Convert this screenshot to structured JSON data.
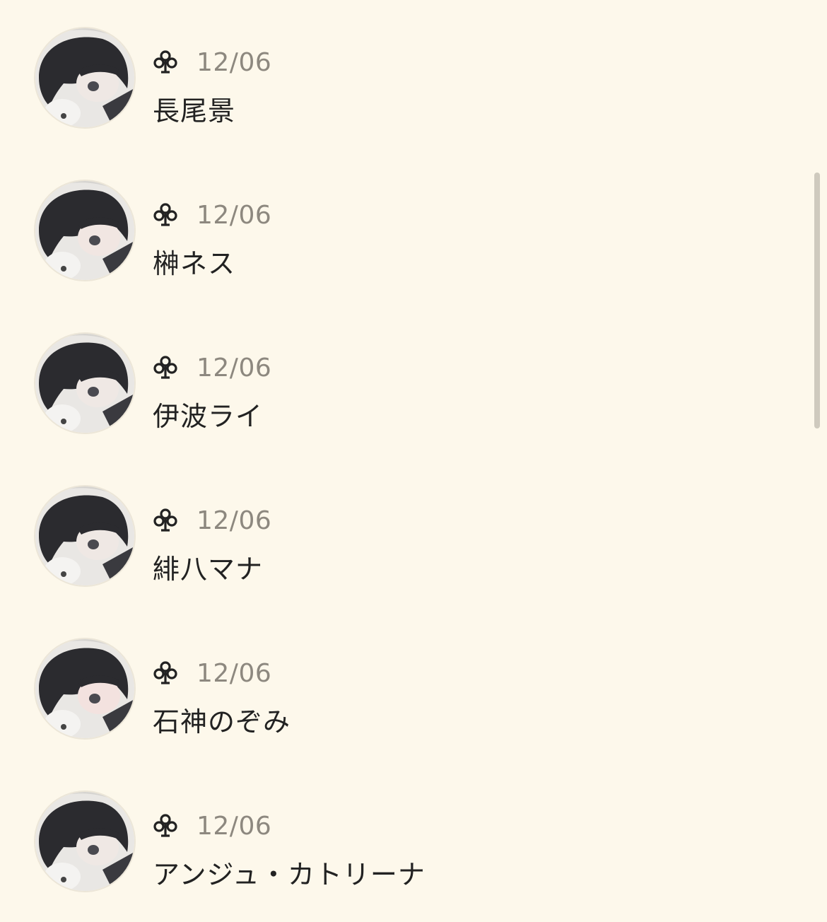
{
  "entries": [
    {
      "date": "12/06",
      "name": "長尾景",
      "icon": "club-icon"
    },
    {
      "date": "12/06",
      "name": "榊ネス",
      "icon": "club-icon"
    },
    {
      "date": "12/06",
      "name": "伊波ライ",
      "icon": "club-icon"
    },
    {
      "date": "12/06",
      "name": "緋八マナ",
      "icon": "club-icon"
    },
    {
      "date": "12/06",
      "name": "石神のぞみ",
      "icon": "club-icon"
    },
    {
      "date": "12/06",
      "name": "アンジュ・カトリーナ",
      "icon": "club-icon"
    }
  ],
  "colors": {
    "background": "#fdf8eb",
    "date": "#8d887f",
    "name": "#222222",
    "scrollbar": "#cfcabe"
  }
}
